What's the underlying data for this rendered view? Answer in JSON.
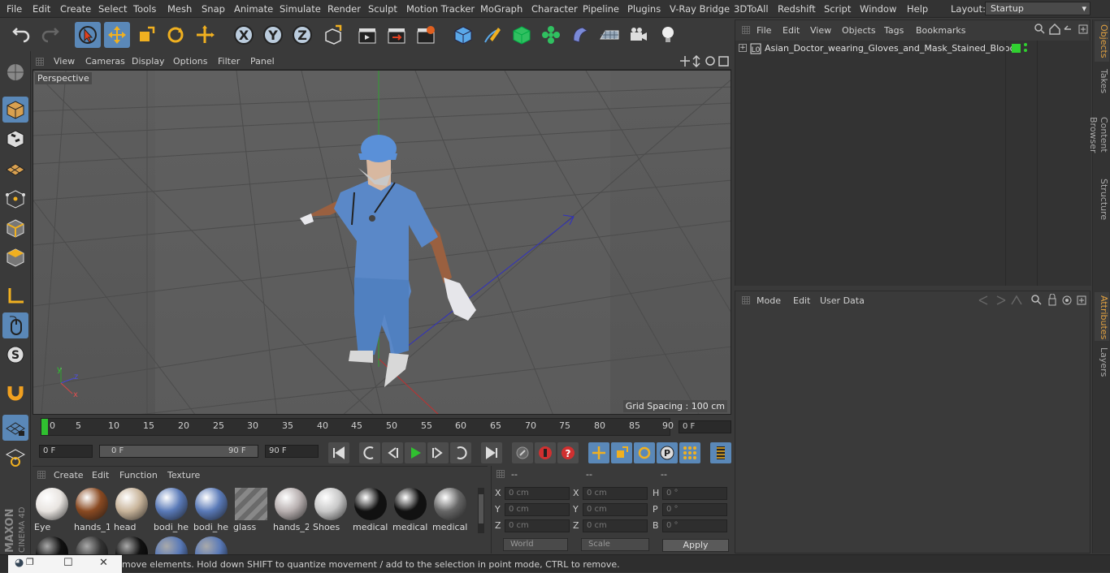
{
  "menubar": {
    "items": [
      "File",
      "Edit",
      "Create",
      "Select",
      "Tools",
      "Mesh",
      "Snap",
      "Animate",
      "Simulate",
      "Render",
      "Sculpt",
      "Motion Tracker",
      "MoGraph",
      "Character",
      "Pipeline",
      "Plugins",
      "V-Ray Bridge",
      "3DToAll",
      "Redshift",
      "Script",
      "Window",
      "Help"
    ],
    "layout_label": "Layout:",
    "layout_value": "Startup"
  },
  "viewport": {
    "menu": [
      "View",
      "Cameras",
      "Display",
      "Options",
      "Filter",
      "Panel"
    ],
    "label": "Perspective",
    "grid_spacing": "Grid Spacing : 100 cm",
    "axes": {
      "y": "y",
      "z": "z",
      "x": "x"
    }
  },
  "timeline": {
    "ticks": [
      "0",
      "5",
      "10",
      "15",
      "20",
      "25",
      "30",
      "35",
      "40",
      "45",
      "50",
      "55",
      "60",
      "65",
      "70",
      "75",
      "80",
      "85",
      "90"
    ],
    "current_frame": "0 F"
  },
  "transport": {
    "start": "0 F",
    "range_start": "0 F",
    "range_end": "90 F",
    "end": "90 F"
  },
  "materials": {
    "menu": [
      "Create",
      "Edit",
      "Function",
      "Texture"
    ],
    "items": [
      {
        "name": "Eye",
        "color": "#e8e4e0"
      },
      {
        "name": "hands_1",
        "color": "#8a4a22"
      },
      {
        "name": "head",
        "color": "#c8b49a"
      },
      {
        "name": "bodi_he",
        "color": "#5a7ab8"
      },
      {
        "name": "bodi_he",
        "color": "#5a7ab8"
      },
      {
        "name": "glass",
        "color": "#777777"
      },
      {
        "name": "hands_2",
        "color": "#b8b0b0"
      },
      {
        "name": "Shoes",
        "color": "#c8c8c8"
      },
      {
        "name": "medical",
        "color": "#111111"
      },
      {
        "name": "medical",
        "color": "#111111"
      },
      {
        "name": "medical",
        "color": "#666666"
      }
    ],
    "row2_colors": [
      "#111111",
      "#333333",
      "#111111",
      "#5a7ab8",
      "#5a7ab8"
    ]
  },
  "coords": {
    "headers": [
      "--",
      "--",
      "--"
    ],
    "rows": [
      {
        "a": "X",
        "av": "0 cm",
        "b": "X",
        "bv": "0 cm",
        "c": "H",
        "cv": "0 °"
      },
      {
        "a": "Y",
        "av": "0 cm",
        "b": "Y",
        "bv": "0 cm",
        "c": "P",
        "cv": "0 °"
      },
      {
        "a": "Z",
        "av": "0 cm",
        "b": "Z",
        "bv": "0 cm",
        "c": "B",
        "cv": "0 °"
      }
    ],
    "space": "World",
    "mode": "Scale",
    "apply": "Apply"
  },
  "objects": {
    "menu": [
      "File",
      "Edit",
      "View",
      "Objects",
      "Tags",
      "Bookmarks"
    ],
    "name": "Asian_Doctor_wearing_Gloves_and_Mask_Stained_Blood"
  },
  "attributes": {
    "menu": [
      "Mode",
      "Edit",
      "User Data"
    ]
  },
  "side_tabs": [
    "Objects",
    "Takes",
    "Content Browser",
    "Structure",
    "Attributes",
    "Layers"
  ],
  "status": "move elements. Hold down SHIFT to quantize movement / add to the selection in point mode, CTRL to remove.",
  "brand": "MAXON CINEMA 4D",
  "colors": {
    "accent": "#5a88b8",
    "active_tab": "#e0a040"
  }
}
